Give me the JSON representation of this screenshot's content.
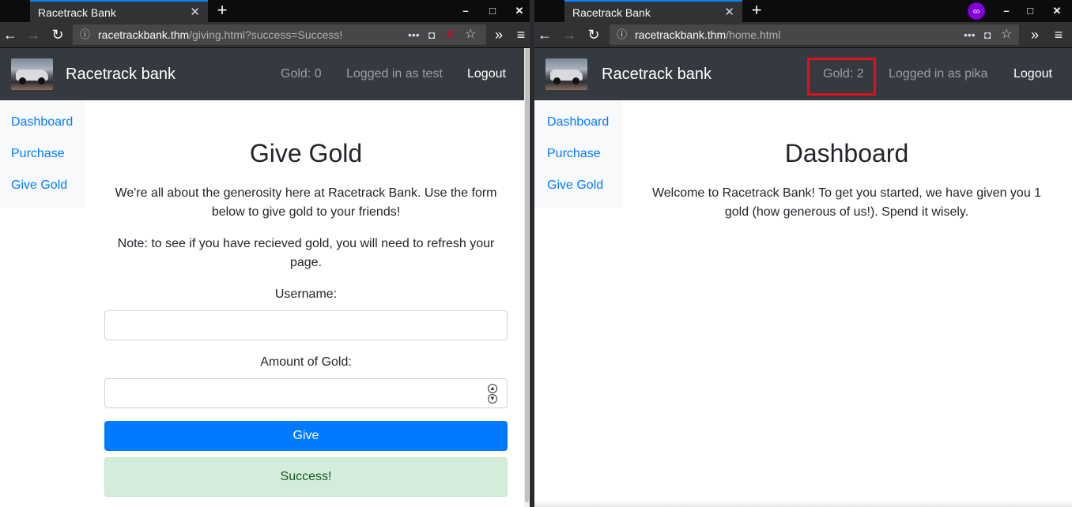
{
  "left": {
    "tab_title": "Racetrack Bank",
    "url_domain": "racetrackbank.thm",
    "url_path": "/giving.html?success=Success!",
    "extension_badge": "4",
    "site": {
      "brand": "Racetrack bank",
      "gold": "Gold: 0",
      "logged_in": "Logged in as test",
      "logout": "Logout"
    },
    "sidebar": [
      "Dashboard",
      "Purchase",
      "Give Gold"
    ],
    "page": {
      "title": "Give Gold",
      "intro": "We're all about the generosity here at Racetrack Bank. Use the form below to give gold to your friends!",
      "note": "Note: to see if you have recieved gold, you will need to refresh your page.",
      "username_label": "Username:",
      "username_value": "",
      "amount_label": "Amount of Gold:",
      "amount_value": "",
      "give_button": "Give",
      "alert": "Success!"
    }
  },
  "right": {
    "tab_title": "Racetrack Bank",
    "url_domain": "racetrackbank.thm",
    "url_path": "/home.html",
    "site": {
      "brand": "Racetrack bank",
      "gold": "Gold: 2",
      "logged_in": "Logged in as pika",
      "logout": "Logout"
    },
    "sidebar": [
      "Dashboard",
      "Purchase",
      "Give Gold"
    ],
    "page": {
      "title": "Dashboard",
      "welcome": "Welcome to Racetrack Bank! To get you started, we have given you 1 gold (how generous of us!). Spend it wisely."
    }
  },
  "colors": {
    "highlight_box": "#e0101a",
    "link": "#007bff",
    "primary_button": "#007bff",
    "success_bg": "#d4edda",
    "navbar_bg": "#343a40"
  }
}
